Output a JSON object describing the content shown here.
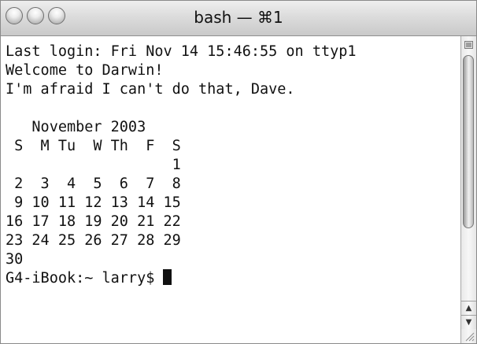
{
  "window": {
    "title": "bash — ⌘1"
  },
  "terminal": {
    "lines": [
      "Last login: Fri Nov 14 15:46:55 on ttyp1",
      "Welcome to Darwin!",
      "I'm afraid I can't do that, Dave.",
      "",
      "   November 2003",
      " S  M Tu  W Th  F  S",
      "                   1",
      " 2  3  4  5  6  7  8",
      " 9 10 11 12 13 14 15",
      "16 17 18 19 20 21 22",
      "23 24 25 26 27 28 29",
      "30"
    ],
    "prompt": "G4-iBook:~ larry$ "
  },
  "icons": {
    "close": "close-button-icon",
    "minimize": "minimize-button-icon",
    "zoom": "zoom-button-icon",
    "scroll_up": "scroll-up-arrow-icon",
    "scroll_down": "scroll-down-arrow-icon",
    "resize": "resize-grip-icon"
  },
  "colors": {
    "text": "#111111",
    "background": "#ffffff",
    "titlebar": "#dcdcdc"
  }
}
